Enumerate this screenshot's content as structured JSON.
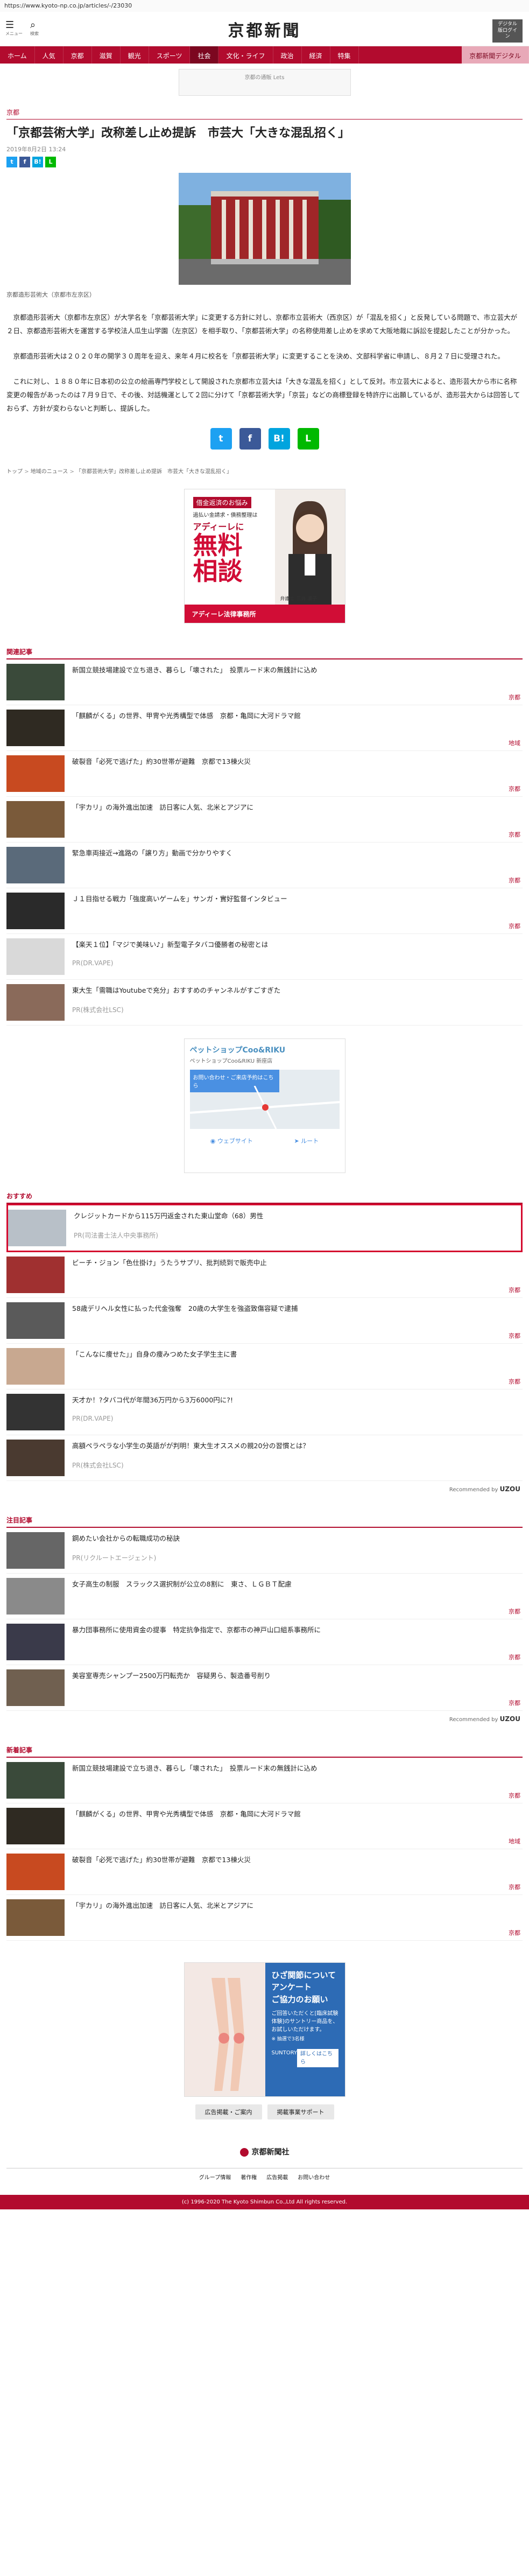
{
  "url_bar": "https://www.kyoto-np.co.jp/articles/-/23030",
  "masthead": {
    "menu_label": "メニュー",
    "search_label": "検索",
    "logo": "京都新聞",
    "digital_button": "デジタル版ログイン"
  },
  "nav": [
    "ホーム",
    "人気",
    "京都",
    "滋賀",
    "観光",
    "スポーツ",
    "社会",
    "文化・ライフ",
    "政治",
    "経済",
    "特集",
    "京都新聞デジタル"
  ],
  "top_ad_label": "京都の通販 Lets",
  "section": "京都",
  "article": {
    "title": "「京都芸術大学」改称差し止め提訴　市芸大「大きな混乱招く」",
    "date": "2019年8月2日 13:24",
    "caption": "京都造形芸術大（京都市左京区）",
    "p1": "京都造形芸術大（京都市左京区）が大学名を「京都芸術大学」に変更する方針に対し、京都市立芸術大（西京区）が「混乱を招く」と反発している問題で、市立芸大が２日、京都造形芸術大を運営する学校法人瓜生山学園（左京区）を相手取り、「京都芸術大学」の名称使用差し止めを求めて大阪地裁に訴訟を提起したことが分かった。",
    "p2": "京都造形芸術大は２０２０年の開学３０周年を迎え、来年４月に校名を「京都芸術大学」に変更することを決め、文部科学省に申請し、８月２７日に受理された。",
    "p3": "これに対し、１８８０年に日本初の公立の絵画専門学校として開設された京都市立芸大は「大きな混乱を招く」として反対。市立芸大によると、造形芸大から市に名称変更の報告があったのは７月９日で、その後、対話機運として２回に分けて「京都芸術大学」「京芸」などの商標登録を特許庁に出願しているが、造形芸大からは回答しておらず、方針が変わらないと判断し、提訴した。"
  },
  "share_buttons": [
    "t",
    "f",
    "B!",
    "L"
  ],
  "breadcrumbs": [
    "トップ",
    "地域のニュース",
    "「京都芸術大学」改称差し止め提訴　市芸大「大きな混乱招く」"
  ],
  "lawyer_ad": {
    "l1": "借金返済のお悩み",
    "l2": "過払い金請求・債務整理は",
    "l3": "アディーレに",
    "big1": "無料",
    "big2": "相談",
    "footer": "アディーレ法律事務所",
    "person": "弁護士 三井 凛子"
  },
  "related": {
    "title": "関連記事",
    "items": [
      {
        "text": "新国立競技場建設で立ち退き、暮らし「壊された」　投票ルード末の無銭計に込め",
        "cat": "京都"
      },
      {
        "text": "「麒麟がくる」の世界、甲冑や光秀構型で体感　京都・亀岡に大河ドラマ館",
        "cat": "地域"
      },
      {
        "text": "破裂音「必死で逃げた」約30世帯が避難　京都で13棟火災",
        "cat": "京都"
      },
      {
        "text": "「宇カリ」の海外進出加速　訪日客に人気、北米とアジアに",
        "cat": "京都"
      },
      {
        "text": "緊急車両接近→進路の「譲り方」動画で分かりやすく",
        "cat": "京都"
      },
      {
        "text": "Ｊ１目指せる戦力「強度高いゲームを」サンガ・實好監督インタビュー",
        "cat": "京都"
      },
      {
        "text": "【楽天１位】「マジで美味い♪」新型電子タバコ優勝者の秘密とは",
        "pr": "PR(DR.VAPE)"
      },
      {
        "text": "東大生「需職はYoutubeで充分」おすすめのチャンネルがすごすぎた",
        "pr": "PR(株式会社LSC)"
      }
    ]
  },
  "map_ad": {
    "title": "ペットショップCoo&RIKU",
    "sub": "ペットショップCoo&RIKU 新座店",
    "desc": "お問い合わせ・ご来店予約はこちら",
    "btn1": "ウェブサイト",
    "btn2": "ルート"
  },
  "recommend": {
    "title": "おすすめ",
    "items": [
      {
        "text": "クレジットカードから115万円返金された東山堂命（68）男性",
        "pr": "PR(司法書士法人中央事務所)",
        "highlight": true
      },
      {
        "text": "ビーチ・ジョン「色仕掛け」うたうサプリ、批判続到で販売中止",
        "cat": "京都"
      },
      {
        "text": "58歳デリヘル女性に払った代金強奪　20歳の大学生を強盗致傷容疑で逮捕",
        "cat": "京都"
      },
      {
        "text": "「こんなに痩せた」」自身の痩みつめた女子学生主に書",
        "cat": "京都"
      },
      {
        "text": "天才か！?タバコ代が年間36万円から3万6000円に?!",
        "pr": "PR(DR.VAPE)"
      },
      {
        "text": "高額ペラペラな小学生の英語がが判明！東大生オススメの親20分の習慣とは？",
        "pr": "PR(株式会社LSC)"
      }
    ],
    "powered": "Recommended by",
    "brand": "UZOU"
  },
  "featured": {
    "title": "注目記事",
    "items": [
      {
        "text": "鋼めたい会社からの転職成功の秘訣",
        "pr": "PR(リクルートエージェント)"
      },
      {
        "text": "女子高生の制服　スラックス選択制が公立の8割に　東さ、ＬＧＢＴ配慮",
        "cat": "京都"
      },
      {
        "text": "暴力団事務所に使用資金の提事　特定抗争指定で、京都市の神戸山口組系事務所に",
        "cat": "京都"
      },
      {
        "text": "美容室専売シャンプー2500万円転売か　容疑男ら、製造番号削り",
        "cat": "京都"
      }
    ],
    "powered": "Recommended by",
    "brand": "UZOU"
  },
  "latest": {
    "title": "新着記事",
    "items": [
      {
        "text": "新国立競技場建設で立ち退き、暮らし「壊された」　投票ルード末の無銭計に込め",
        "cat": "京都"
      },
      {
        "text": "「麒麟がくる」の世界、甲冑や光秀構型で体感　京都・亀岡に大河ドラマ館",
        "cat": "地域"
      },
      {
        "text": "破裂音「必死で逃げた」約30世帯が避難　京都で13棟火災",
        "cat": "京都"
      },
      {
        "text": "「宇カリ」の海外進出加速　訪日客に人気、北米とアジアに",
        "cat": "京都"
      }
    ]
  },
  "bottom_ad": {
    "t1": "ひざ関節について",
    "t2": "アンケート",
    "t3": "ご協力のお願い",
    "body": "ご回答いただくと[臨床試験体験]のサントリー商品を、お試しいただけます。",
    "note": "※ 抽選で3名様",
    "brand": "SUNTORY",
    "btn": "詳しくはこちら"
  },
  "links": [
    "広告掲載・ご案内",
    "掲載事業サポート"
  ],
  "footer": {
    "logo": "京都新聞社",
    "links": [
      "グループ情報",
      "著作権",
      "広告掲載",
      "お問い合わせ"
    ],
    "copyright": "(c) 1996-2020 The Kyoto Shimbun Co.,Ltd All rights reserved."
  }
}
